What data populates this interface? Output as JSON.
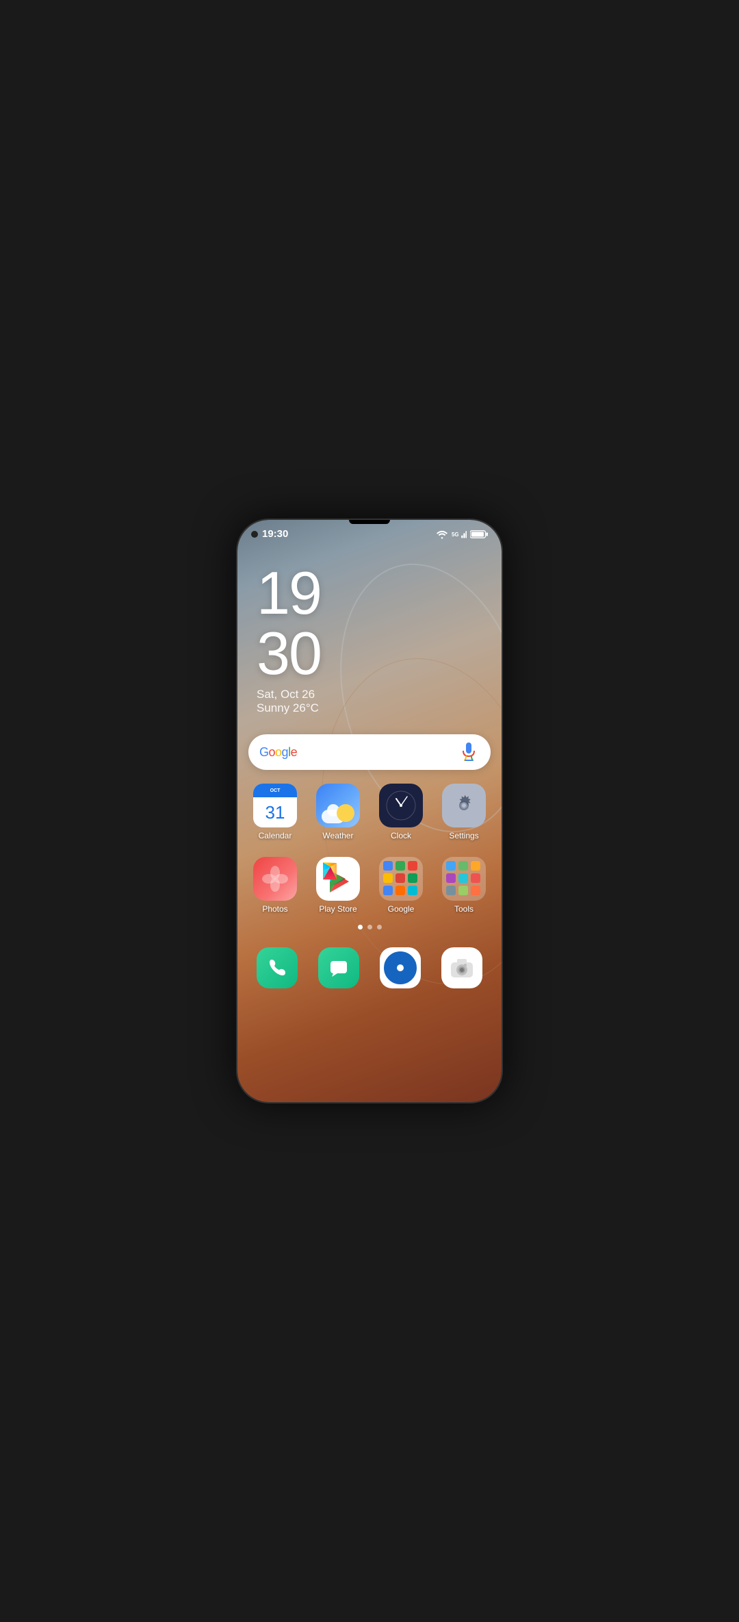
{
  "phone": {
    "statusBar": {
      "time": "19:30",
      "wifi": true,
      "signal": "5G",
      "battery": "full"
    },
    "clockWidget": {
      "hour": "19",
      "minute": "30",
      "date": "Sat, Oct 26",
      "weather": "Sunny 26°C"
    },
    "searchBar": {
      "placeholder": "Google",
      "brand": "Google"
    },
    "apps": [
      {
        "id": "calendar",
        "label": "Calendar",
        "icon": "calendar",
        "number": "31"
      },
      {
        "id": "weather",
        "label": "Weather",
        "icon": "weather"
      },
      {
        "id": "clock",
        "label": "Clock",
        "icon": "clock"
      },
      {
        "id": "settings",
        "label": "Settings",
        "icon": "settings"
      },
      {
        "id": "photos",
        "label": "Photos",
        "icon": "photos"
      },
      {
        "id": "playstore",
        "label": "Play Store",
        "icon": "playstore"
      },
      {
        "id": "google",
        "label": "Google",
        "icon": "google-folder"
      },
      {
        "id": "tools",
        "label": "Tools",
        "icon": "tools"
      }
    ],
    "pageIndicators": [
      {
        "active": true
      },
      {
        "active": false
      },
      {
        "active": false
      }
    ],
    "dock": [
      {
        "id": "phone",
        "icon": "phone"
      },
      {
        "id": "messages",
        "icon": "messages"
      },
      {
        "id": "music",
        "icon": "music"
      },
      {
        "id": "camera",
        "icon": "camera"
      }
    ]
  },
  "colors": {
    "accent": "#34d399",
    "clockText": "#ffffff",
    "appLabelColor": "#ffffff"
  }
}
